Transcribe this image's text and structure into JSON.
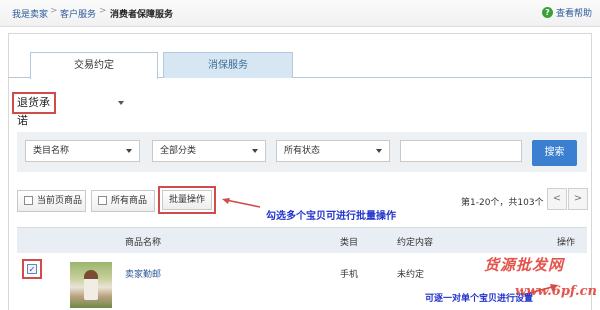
{
  "breadcrumb": {
    "items": [
      {
        "label": "我是卖家"
      },
      {
        "label": "客户服务"
      },
      {
        "label": "消费者保障服务"
      }
    ],
    "separator": ">"
  },
  "help": {
    "icon": "help-icon",
    "icon_glyph": "?",
    "label": "查看帮助"
  },
  "tabs": [
    {
      "label": "交易约定",
      "active": true
    },
    {
      "label": "消保服务",
      "active": false
    }
  ],
  "returns_select": {
    "value": "退货承诺"
  },
  "filters": {
    "category": {
      "value": "类目名称"
    },
    "classification": {
      "value": "全部分类"
    },
    "status": {
      "value": "所有状态"
    },
    "search_input": {
      "placeholder": "",
      "value": ""
    },
    "search_button": "搜索"
  },
  "toolbar": {
    "current_page_label": "当前页商品",
    "all_items_label": "所有商品",
    "batch_label": "批量操作",
    "batch_annotation": "勾选多个宝贝可进行批量操作",
    "pager": {
      "summary": "第1-20个，共103个",
      "prev": "<",
      "next": ">"
    }
  },
  "table": {
    "columns": [
      "商品名称",
      "类目",
      "约定内容",
      "操作"
    ],
    "rows": [
      {
        "checked": true,
        "check_glyph": "✓",
        "name": "卖家勤邮",
        "category": "手机",
        "agreement": "未约定",
        "action": ""
      }
    ],
    "row_annotation": "可逐一对单个宝贝进行设置"
  },
  "watermark": {
    "line1": "货源批发网",
    "line2": "www.6pf.cn"
  },
  "colors": {
    "annotation_red": "#d24b4b",
    "annotation_blue": "#2233cc",
    "link": "#2a5a9a",
    "search_button": "#3a7fd0",
    "tab_inactive_bg": "#d6e7f3"
  }
}
